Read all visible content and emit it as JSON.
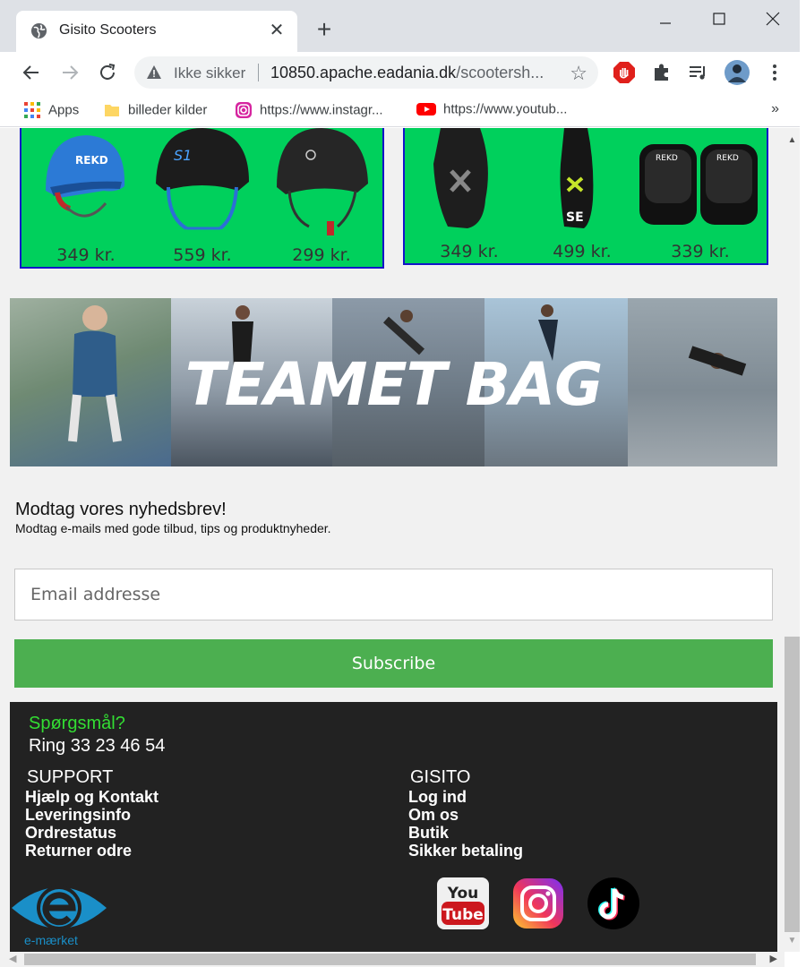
{
  "browser": {
    "tab_title": "Gisito Scooters",
    "security_label": "Ikke sikker",
    "url_host": "10850.apache.eadania.dk",
    "url_path": "/scootersh...",
    "bookmarks": [
      "Apps",
      "billeder kilder",
      "https://www.instagr...",
      "https://www.youtub..."
    ],
    "bookmarks_more": "»"
  },
  "products": {
    "helmets": [
      "349 kr.",
      "559 kr.",
      "299 kr."
    ],
    "pads": [
      "349 kr.",
      "499 kr.",
      "339 kr."
    ]
  },
  "banner": {
    "title": "TEAMET BAG"
  },
  "newsletter": {
    "title": "Modtag vores nyhedsbrev!",
    "text": "Modtag e-mails med gode tilbud, tips og produktnyheder.",
    "email_placeholder": "Email addresse",
    "subscribe_label": "Subscribe"
  },
  "footer": {
    "question": "Spørgsmål?",
    "phone": "Ring 33 23 46 54",
    "support_heading": "SUPPORT",
    "support_links": [
      "Hjælp og Kontakt",
      "Leveringsinfo",
      "Ordrestatus",
      "Returner odre"
    ],
    "gisito_heading": "GISITO",
    "gisito_links": [
      "Log ind",
      "Om os",
      "Butik",
      "Sikker betaling"
    ],
    "emark_label": "e-mærket",
    "youtube_logo_text": [
      "You",
      "Tube"
    ]
  },
  "colors": {
    "product_bg": "#00d05c",
    "product_border": "#1414c8",
    "subscribe_green": "#4caf50",
    "footer_bg": "#222222",
    "question_green": "#33dd33"
  }
}
